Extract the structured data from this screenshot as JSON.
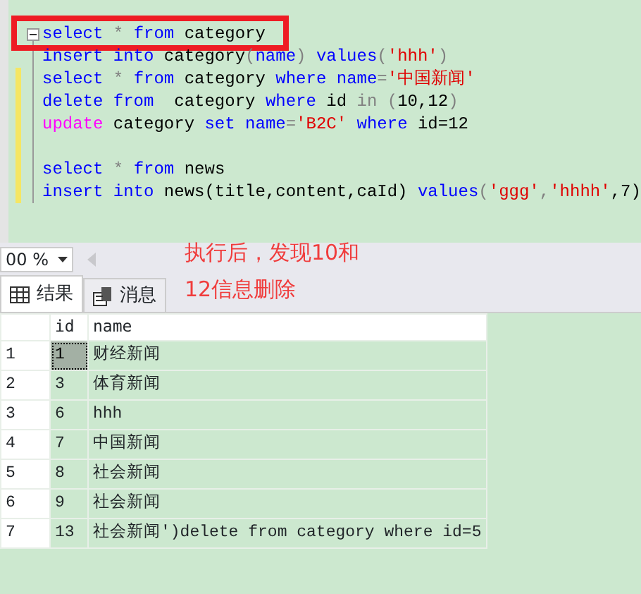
{
  "editor": {
    "lines": [
      {
        "changed": false,
        "foldable": true,
        "tokens": [
          {
            "text": "select",
            "kind": "keyword"
          },
          {
            "text": " * ",
            "kind": "operator"
          },
          {
            "text": "from",
            "kind": "keyword"
          },
          {
            "text": " category",
            "kind": "plain"
          }
        ]
      },
      {
        "changed": false,
        "foldable": false,
        "tokens": [
          {
            "text": "insert into",
            "kind": "keyword"
          },
          {
            "text": " category",
            "kind": "plain"
          },
          {
            "text": "(",
            "kind": "operator"
          },
          {
            "text": "name",
            "kind": "keyword"
          },
          {
            "text": ")",
            "kind": "operator"
          },
          {
            "text": " values",
            "kind": "keyword"
          },
          {
            "text": "(",
            "kind": "operator"
          },
          {
            "text": "'hhh'",
            "kind": "string"
          },
          {
            "text": ")",
            "kind": "operator"
          }
        ]
      },
      {
        "changed": true,
        "foldable": false,
        "tokens": [
          {
            "text": "select",
            "kind": "keyword"
          },
          {
            "text": " * ",
            "kind": "operator"
          },
          {
            "text": "from",
            "kind": "keyword"
          },
          {
            "text": " category ",
            "kind": "plain"
          },
          {
            "text": "where name",
            "kind": "keyword"
          },
          {
            "text": "=",
            "kind": "operator"
          },
          {
            "text": "'中国新闻'",
            "kind": "string"
          }
        ]
      },
      {
        "changed": true,
        "foldable": false,
        "tokens": [
          {
            "text": "delete from",
            "kind": "keyword"
          },
          {
            "text": "  category ",
            "kind": "plain"
          },
          {
            "text": "where",
            "kind": "keyword"
          },
          {
            "text": " id ",
            "kind": "plain"
          },
          {
            "text": "in (",
            "kind": "operator"
          },
          {
            "text": "10,12",
            "kind": "plain"
          },
          {
            "text": ")",
            "kind": "operator"
          }
        ]
      },
      {
        "changed": true,
        "foldable": false,
        "tokens": [
          {
            "text": "update",
            "kind": "function"
          },
          {
            "text": " category ",
            "kind": "plain"
          },
          {
            "text": "set name",
            "kind": "keyword"
          },
          {
            "text": "=",
            "kind": "operator"
          },
          {
            "text": "'B2C'",
            "kind": "string"
          },
          {
            "text": " where",
            "kind": "keyword"
          },
          {
            "text": " id=12",
            "kind": "plain"
          }
        ]
      },
      {
        "changed": true,
        "foldable": false
      },
      {
        "changed": true,
        "foldable": false,
        "tokens": [
          {
            "text": "select",
            "kind": "keyword"
          },
          {
            "text": " * ",
            "kind": "operator"
          },
          {
            "text": "from",
            "kind": "keyword"
          },
          {
            "text": " news",
            "kind": "plain"
          }
        ]
      },
      {
        "changed": true,
        "foldable": false,
        "tokens": [
          {
            "text": "insert into",
            "kind": "keyword"
          },
          {
            "text": " news(title,content,caId) ",
            "kind": "plain"
          },
          {
            "text": "values",
            "kind": "keyword"
          },
          {
            "text": "(",
            "kind": "operator"
          },
          {
            "text": "'ggg'",
            "kind": "string"
          },
          {
            "text": ",",
            "kind": "operator"
          },
          {
            "text": "'hhhh'",
            "kind": "string"
          },
          {
            "text": ",7)",
            "kind": "plain"
          }
        ]
      }
    ]
  },
  "annotation": {
    "lines": [
      "执行后，发现10和",
      "12信息删除"
    ]
  },
  "zoom": {
    "value": "00 %"
  },
  "tabs": [
    {
      "label": "结果",
      "selected": true
    },
    {
      "label": "消息",
      "selected": false
    }
  ],
  "grid": {
    "columns": [
      "id",
      "name"
    ],
    "rows": [
      {
        "number": "1",
        "selected": true,
        "cells": [
          "1",
          "财经新闻"
        ]
      },
      {
        "number": "2",
        "selected": false,
        "cells": [
          "3",
          "体育新闻"
        ]
      },
      {
        "number": "3",
        "selected": false,
        "cells": [
          "6",
          "hhh"
        ]
      },
      {
        "number": "4",
        "selected": false,
        "cells": [
          "7",
          "中国新闻"
        ]
      },
      {
        "number": "5",
        "selected": false,
        "cells": [
          "8",
          "社会新闻"
        ]
      },
      {
        "number": "6",
        "selected": false,
        "cells": [
          "9",
          "社会新闻"
        ]
      },
      {
        "number": "7",
        "selected": false,
        "cells": [
          "13",
          "社会新闻')delete from category where id=5"
        ]
      }
    ]
  }
}
